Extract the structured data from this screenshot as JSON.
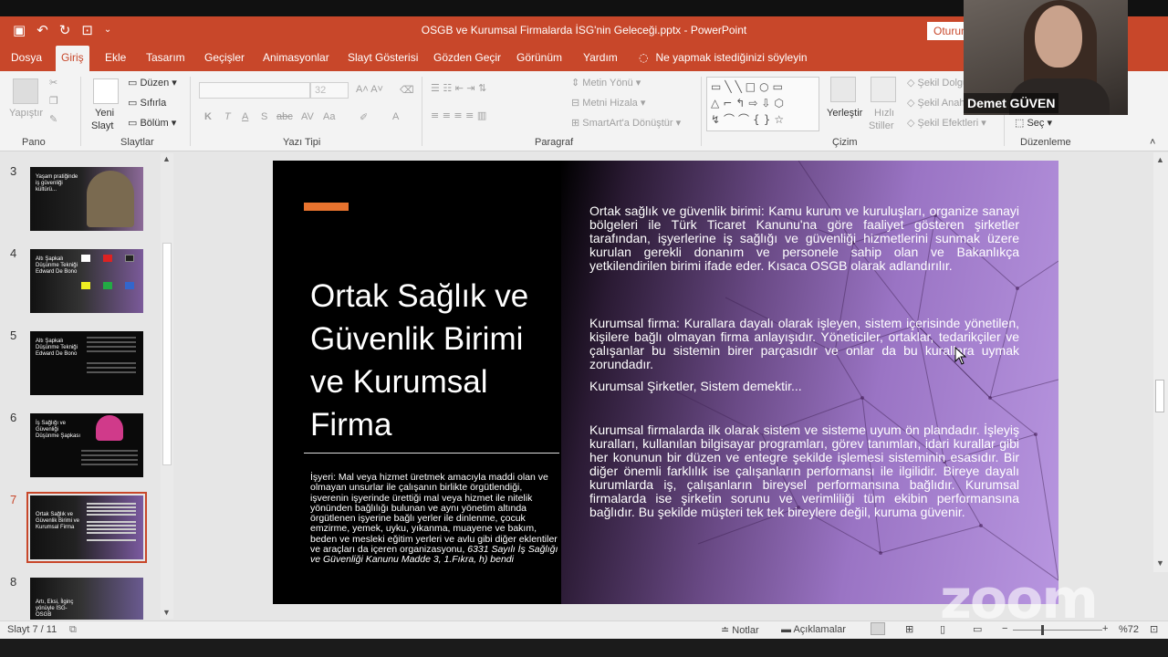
{
  "titlebar": {
    "document_title": "OSGB ve Kurumsal Firmalarda İSG'nin Geleceği.pptx  -  PowerPoint",
    "signin_label": "Oturum"
  },
  "tabs": [
    "Dosya",
    "Giriş",
    "Ekle",
    "Tasarım",
    "Geçişler",
    "Animasyonlar",
    "Slayt Gösterisi",
    "Gözden Geçir",
    "Görünüm",
    "Yardım"
  ],
  "active_tab": "Giriş",
  "tell_me": "Ne yapmak istediğinizi söyleyin",
  "ribbon": {
    "groups": [
      "Pano",
      "Slaytlar",
      "Yazı Tipi",
      "Paragraf",
      "Çizim",
      "Düzenleme"
    ],
    "pano": {
      "paste": "Yapıştır"
    },
    "slaytlar": {
      "new_slide_1": "Yeni",
      "new_slide_2": "Slayt",
      "layout": "Düzen",
      "reset": "Sıfırla",
      "section": "Bölüm"
    },
    "font": {
      "size": "32",
      "bold": "K",
      "italic": "T",
      "underline": "A",
      "shadow": "S",
      "strike": "abc",
      "spacing": "AV",
      "case": "Aa",
      "color": "A"
    },
    "paragraph": {
      "text_direction": "Metin Yönü",
      "align_text": "Metni Hizala",
      "smartart": "SmartArt'a Dönüştür"
    },
    "drawing": {
      "arrange": "Yerleştir",
      "quick_styles_1": "Hızlı",
      "quick_styles_2": "Stiller",
      "shape_fill": "Şekil Dolgusu",
      "shape_outline": "Şekil Anahattı",
      "shape_effects": "Şekil Efektleri"
    },
    "editing": {
      "select": "Seç"
    }
  },
  "thumbnails": [
    {
      "number": "3",
      "text": "Yaşam pratiğinde iş güvenliği kültürü..."
    },
    {
      "number": "4",
      "text": "Altı Şapkalı Düşünme Tekniği Edward De Bono"
    },
    {
      "number": "5",
      "text": "Altı Şapkalı Düşünme Tekniği Edward De Bono"
    },
    {
      "number": "6",
      "text": "İş Sağlığı ve Güvenliği Düşünme Şapkası"
    },
    {
      "number": "7",
      "text": "Ortak Sağlık ve Güvenlik Birimi ve Kurumsal Firma"
    },
    {
      "number": "8",
      "text": "Artı, Eksi, İlginç yönüyle İSG-OSGB"
    }
  ],
  "active_slide": "7",
  "slide": {
    "title": "Ortak Sağlık ve Güvenlik Birimi ve Kurumsal Firma",
    "note": "İşyeri: Mal veya hizmet üretmek amacıyla maddi olan ve olmayan unsurlar ile çalışanın birlikte örgütlendiği, işverenin işyerinde ürettiği mal veya hizmet ile nitelik yönünden bağlılığı bulunan ve aynı yönetim altında örgütlenen işyerine bağlı yerler ile dinlenme, çocuk emzirme, yemek, uyku, yıkanma, muayene ve bakım, beden ve mesleki eğitim yerleri ve avlu gibi diğer eklentiler ve araçları da içeren organizasyonu, ",
    "note_citation": "6331 Sayılı İş Sağlığı ve Güvenliği Kanunu Madde 3, 1.Fıkra, h) bendi",
    "paragraphs": [
      "Ortak sağlık ve güvenlik birimi: Kamu kurum ve kuruluşları, organize sanayi bölgeleri ile Türk Ticaret Kanunu'na göre faaliyet gösteren şirketler tarafından, işyerlerine iş sağlığı ve güvenliği hizmetlerini sunmak üzere kurulan gerekli donanım ve personele sahip olan ve Bakanlıkça yetkilendirilen birimi ifade eder. Kısaca OSGB olarak adlandırılır.",
      "Kurumsal firma: Kurallara dayalı olarak işleyen, sistem içerisinde yönetilen, kişilere bağlı olmayan firma anlayışıdır. Yöneticiler, ortaklar, tedarikçiler ve çalışanlar bu sistemin birer parçasıdır ve onlar da bu kurallara uymak zorundadır.",
      "Kurumsal Şirketler, Sistem demektir...",
      "Kurumsal firmalarda ilk olarak sistem ve sisteme uyum ön plandadır. İşleyiş kuralları, kullanılan bilgisayar programları, görev tanımları, idari kurallar gibi her konunun bir düzen ve entegre şekilde işlemesi sisteminin esasıdır. Bir diğer önemli farklılık ise çalışanların performansı ile ilgilidir. Bireye dayalı kurumlarda iş, çalışanların bireysel performansına bağlıdır. Kurumsal firmalarda ise şirketin sorunu ve verimliliği tüm ekibin performansına bağlıdır. Bu şekilde müşteri tek tek bireylere değil, kuruma güvenir."
    ]
  },
  "status": {
    "slide_counter": "Slayt 7 / 11",
    "notes": "Notlar",
    "comments": "Açıklamalar",
    "zoom": "%72"
  },
  "webcam": {
    "participant_name": "Demet GÜVEN"
  },
  "overlay": {
    "zoom_watermark": "zoom"
  },
  "colors": {
    "accent": "#c8472a",
    "slide_orange": "#e8732e",
    "slide_purple": "#9a74c4"
  }
}
